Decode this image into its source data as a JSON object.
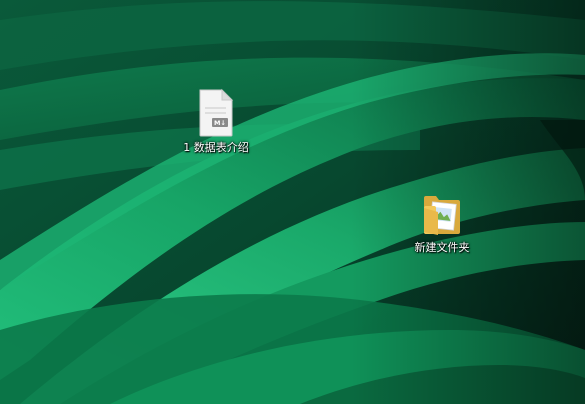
{
  "desktop": {
    "icons": [
      {
        "label": "1 数据表介绍",
        "icon": "markdown-file-icon",
        "badge": "M↓"
      },
      {
        "label": "新建文件夹",
        "icon": "folder-icon"
      }
    ]
  },
  "colors": {
    "wallpaper_dark": "#063c28",
    "wallpaper_mid": "#0f8a55",
    "wallpaper_light": "#2fd08a",
    "label_text": "#ffffff",
    "folder_yellow": "#f3c85a"
  }
}
